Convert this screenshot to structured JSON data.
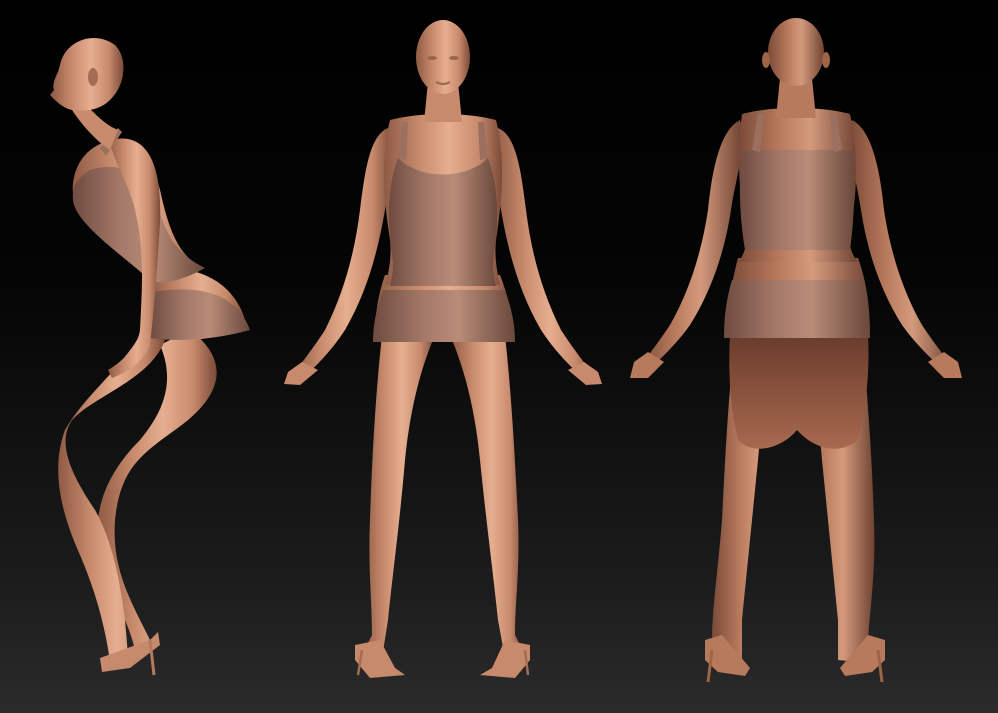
{
  "scene": {
    "colors": {
      "skin_light": "#e2a88a",
      "skin_mid": "#c88a6c",
      "skin_dark": "#8e5a44",
      "cloth_light": "#b88c77",
      "cloth_mid": "#9b7060",
      "cloth_dark": "#6e4c40",
      "background_top": "#000000",
      "background_bottom": "#2b2b2b"
    },
    "views": [
      {
        "name": "side"
      },
      {
        "name": "front"
      },
      {
        "name": "back"
      }
    ]
  }
}
